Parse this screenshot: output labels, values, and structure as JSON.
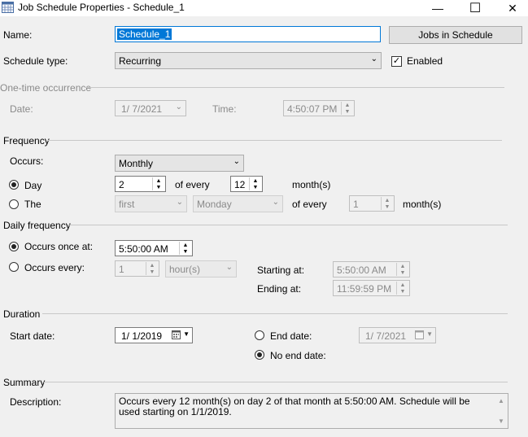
{
  "window": {
    "title": "Job Schedule Properties - Schedule_1",
    "minimize": "—",
    "maximize": "☐",
    "close": "✕"
  },
  "top": {
    "name_label": "Name:",
    "name_value": "Schedule_1",
    "jobs_button": "Jobs in Schedule",
    "type_label": "Schedule type:",
    "type_value": "Recurring",
    "enabled_label": "Enabled",
    "enabled_checked": true
  },
  "onetime": {
    "header": "One-time occurrence",
    "date_label": "Date:",
    "date_value": "1/ 7/2021",
    "time_label": "Time:",
    "time_value": "4:50:07 PM"
  },
  "frequency": {
    "header": "Frequency",
    "occurs_label": "Occurs:",
    "occurs_value": "Monthly",
    "day_label": "Day",
    "day_value": "2",
    "of_every": "of every",
    "months_value": "12",
    "months_label": "month(s)",
    "the_label": "The",
    "the_ordinal": "first",
    "the_weekday": "Monday",
    "the_of_every": "of every",
    "the_months_value": "1",
    "the_months_label": "month(s)"
  },
  "daily": {
    "header": "Daily frequency",
    "once_label": "Occurs once at:",
    "once_value": "5:50:00 AM",
    "every_label": "Occurs every:",
    "every_value": "1",
    "every_unit": "hour(s)",
    "starting_label": "Starting at:",
    "starting_value": "5:50:00 AM",
    "ending_label": "Ending at:",
    "ending_value": "11:59:59 PM"
  },
  "duration": {
    "header": "Duration",
    "start_label": "Start date:",
    "start_value": "1/ 1/2019",
    "end_label": "End date:",
    "end_value": "1/ 7/2021",
    "noend_label": "No end date:"
  },
  "summary": {
    "header": "Summary",
    "desc_label": "Description:",
    "desc_text": "Occurs every 12 month(s) on day 2 of that month at 5:50:00 AM. Schedule will be used starting on 1/1/2019."
  },
  "icons": {
    "app": "calendar-icon",
    "dropdown": "chevron-down-icon",
    "calendar": "calendar-icon"
  },
  "colors": {
    "selection": "#0078d7",
    "focus_border": "#0078d7"
  }
}
